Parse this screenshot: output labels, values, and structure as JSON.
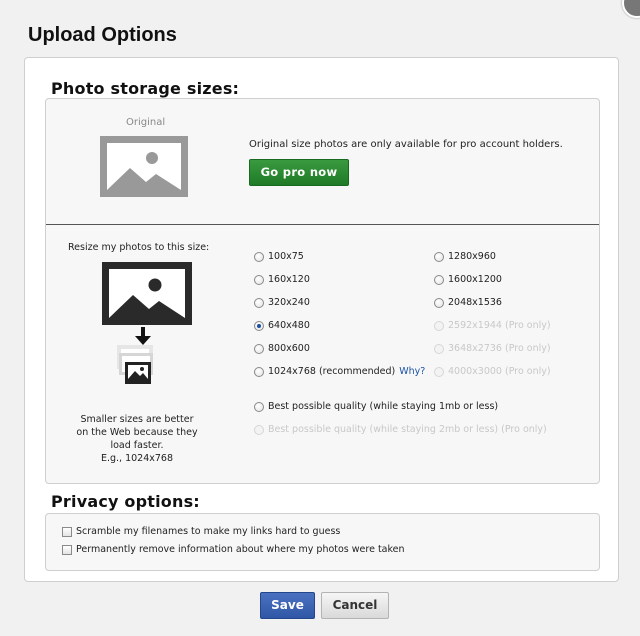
{
  "header": {
    "title": "Upload Options"
  },
  "storage": {
    "heading": "Photo storage sizes:",
    "original_label": "Original",
    "original_text": "Original size photos are only available for pro account holders.",
    "go_pro_label": "Go pro now",
    "resize_label": "Resize my photos to this size:",
    "note_lines": [
      "Smaller sizes are better",
      "on the Web because they",
      "load faster.",
      "E.g., 1024x768"
    ],
    "left_options": [
      "100x75",
      "160x120",
      "320x240",
      "640x480",
      "800x600",
      "1024x768 (recommended)"
    ],
    "why_label": "Why?",
    "right_options": [
      "1280x960",
      "1600x1200",
      "2048x1536",
      "2592x1944 (Pro only)",
      "3648x2736 (Pro only)",
      "4000x3000 (Pro only)"
    ],
    "quality_1mb": "Best possible quality (while staying 1mb or less)",
    "quality_2mb": "Best possible quality (while staying 2mb or less) (Pro only)",
    "selected": "640x480"
  },
  "privacy": {
    "heading": "Privacy options:",
    "scramble_label": "Scramble my filenames to make my links hard to guess",
    "remove_location_label": "Permanently remove information about where my photos were taken"
  },
  "footer": {
    "save_label": "Save",
    "cancel_label": "Cancel"
  },
  "colors": {
    "go_pro": "#1f7a27",
    "save": "#2f57a6",
    "link": "#1c54a8"
  }
}
